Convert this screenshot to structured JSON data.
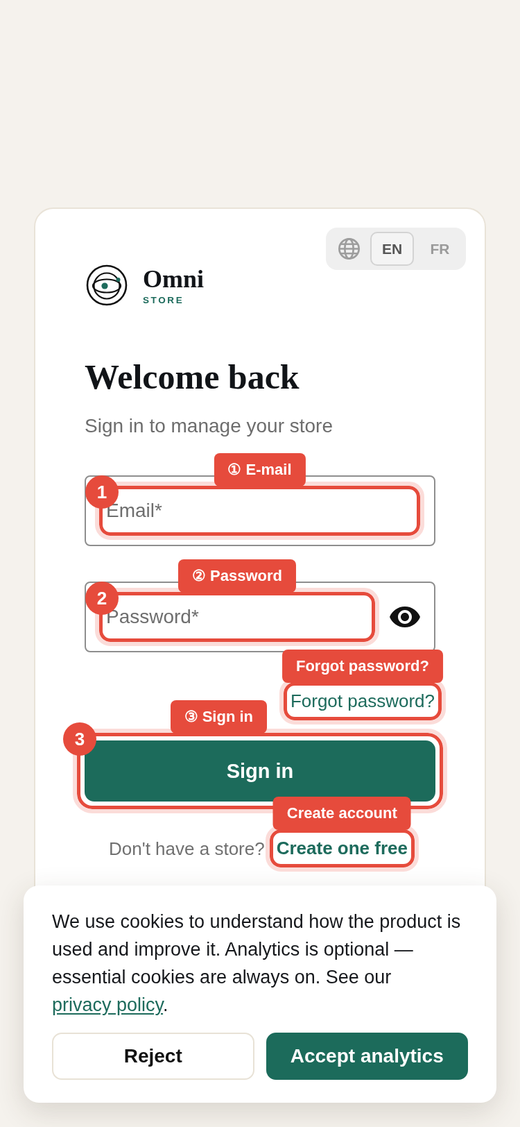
{
  "language_switcher": {
    "options": [
      {
        "label": "EN",
        "selected": true
      },
      {
        "label": "FR",
        "selected": false
      }
    ]
  },
  "brand": {
    "name": "Omni",
    "tagline": "STORE"
  },
  "heading": "Welcome back",
  "subheading": "Sign in to manage your store",
  "form": {
    "fields": [
      {
        "kind": "email",
        "placeholder": "Email*",
        "annotation": {
          "badge": "1",
          "label": "① E-mail"
        }
      },
      {
        "kind": "password",
        "placeholder": "Password*",
        "annotation": {
          "badge": "2",
          "label": "② Password"
        }
      }
    ],
    "forgot_link": {
      "text": "Forgot password?",
      "annotation": {
        "label": "Forgot password?"
      }
    },
    "submit_button": {
      "text": "Sign in",
      "annotation": {
        "badge": "3",
        "label": "③ Sign in"
      }
    },
    "signup": {
      "prompt": "Don't have a store?",
      "link": "Create one free",
      "annotation": {
        "label": "Create account"
      }
    }
  },
  "cookie_banner": {
    "text": "We use cookies to understand how the product is used and improve it. Analytics is optional — essential cookies are always on. See our",
    "link": "privacy policy",
    "text_after": ".",
    "buttons": [
      {
        "kind": "secondary",
        "label": "Reject"
      },
      {
        "kind": "primary",
        "label": "Accept analytics"
      }
    ]
  }
}
